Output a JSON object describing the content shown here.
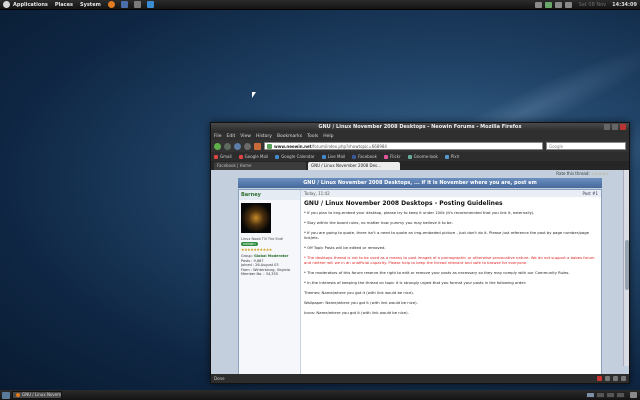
{
  "top_panel": {
    "menus": [
      "Applications",
      "Places",
      "System"
    ],
    "clock_date": "Sat 08 Nov",
    "clock_time": "14:34:09"
  },
  "window": {
    "title": "GNU / Linux November 2008 Desktops - Neowin Forums - Mozilla Firefox",
    "menubar": [
      "File",
      "Edit",
      "View",
      "History",
      "Bookmarks",
      "Tools",
      "Help"
    ],
    "url_host": "www.neowin.net",
    "url_path": "/forum/index.php?showtopic=668984",
    "search_placeholder": "Google",
    "bookmarks": [
      "Gmail",
      "Google Mail",
      "Google Calendar",
      "Live Mail",
      "Facebook",
      "Flickr",
      "Gnome-look",
      "Pixlr"
    ],
    "tabs": [
      {
        "label": "Facebook | Home",
        "active": false
      },
      {
        "label": "GNU / Linux November 2008 Des...",
        "active": true
      }
    ],
    "status": "Done"
  },
  "page": {
    "rate_label": "Rate this thread:",
    "rate_stars": "☆☆☆☆☆",
    "thread_title": "GNU / Linux November 2008 Desktops, ... if it is November where you are, post em",
    "post": {
      "author": "Barney",
      "time": "Today, 11:42",
      "number": "Post #1",
      "user_title": "Linux Noob Till The End!",
      "badge": "neowin",
      "stars": "★★★★★★★★★★",
      "group_label": "Group:",
      "group": "Global Moderator",
      "posts": "Posts : 9,687",
      "joined": "Joined : 26-August 03",
      "from": "From : Wintersburg, Virginia",
      "member_no": "Member No. : 34,355",
      "title": "GNU / Linux November 2008 Desktops - Posting Guidelines",
      "paragraphs": [
        {
          "text": "* If you plan to img-embed your desktop, please try to keep it under 100k (It's recommended that you link it, externally).",
          "red": false
        },
        {
          "text": "* Stay within the board rules, no matter how yummy you may believe it to be.",
          "red": false
        },
        {
          "text": "* If you are going to quote, there isn't a need to quote an img-embeded picture - Just don't do it. Please just reference the post by page number/page link/etc.",
          "red": false
        },
        {
          "text": "* Off Topic Posts will be edited or removed.",
          "red": false
        },
        {
          "text": "* The desktops thread is not to be used as a means to post images of a pornographic or otherwise provocative nature. We do not support a babes forum and neither will we in an unofficial capacity. Please help to keep the thread relevant and safe to browse for everyone.",
          "red": true
        },
        {
          "text": "* The moderators of this forum reserve the right to edit or remove your posts as necessary so they may comply with our Community Rules.",
          "red": false
        },
        {
          "text": "* In the interests of keeping the thread on topic it is strongly urged that you format your posts in the following order:",
          "red": false
        },
        {
          "text": "Themes: Name/where you got it (with link would be nice).",
          "red": false
        },
        {
          "text": "Wallpaper: Name/where you got it (with link would be nice).",
          "red": false
        },
        {
          "text": "Icons: Name/where you got it (with link would be nice).",
          "red": false
        }
      ]
    }
  },
  "taskbar": {
    "task_label": "GNU / Linux November..."
  }
}
